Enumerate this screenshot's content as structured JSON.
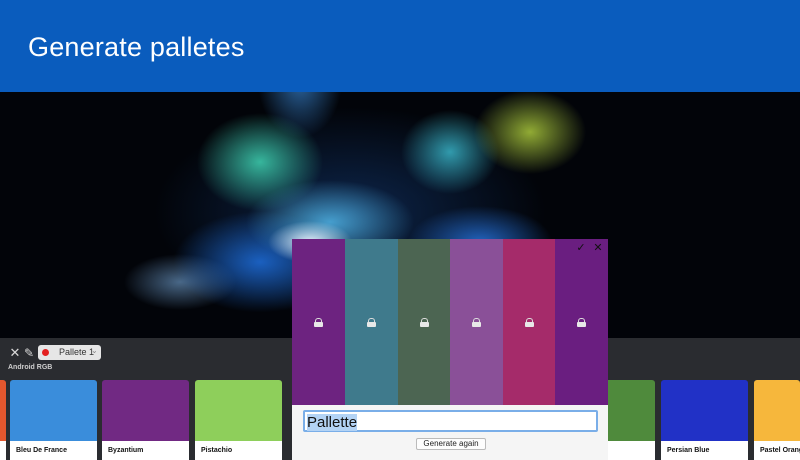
{
  "header": {
    "title": "Generate palletes"
  },
  "toolbar": {
    "close_icon": "close-icon",
    "picker_icon": "eyedropper-icon",
    "pallete_select": {
      "value": "Pallete 1",
      "dot_color": "#e32020"
    },
    "section_label": "Android RGB"
  },
  "color_tiles": [
    {
      "name": "",
      "color": "#e4572e"
    },
    {
      "name": "Bleu De France",
      "color": "#3a8ddb"
    },
    {
      "name": "Byzantium",
      "color": "#712983"
    },
    {
      "name": "Pistachio",
      "color": "#8ecf5b"
    },
    {
      "name": "",
      "color": "#4f8a3c"
    },
    {
      "name": "Persian Blue",
      "color": "#2131c6"
    },
    {
      "name": "Pastel Orange",
      "color": "#f6b73c"
    }
  ],
  "dialog": {
    "confirm_icon": "checkmark-icon",
    "close_icon": "close-icon",
    "strips": [
      {
        "color": "#6d2380",
        "lock_icon": "lock-icon"
      },
      {
        "color": "#3f7a8c",
        "lock_icon": "lock-icon"
      },
      {
        "color": "#4c6552",
        "lock_icon": "lock-icon"
      },
      {
        "color": "#8a5098",
        "lock_icon": "lock-icon"
      },
      {
        "color": "#a52b6a",
        "lock_icon": "lock-icon"
      },
      {
        "color": "#6a1e80",
        "lock_icon": "lock-icon"
      }
    ],
    "name_value": "Pallette",
    "generate_label": "Generate again"
  }
}
